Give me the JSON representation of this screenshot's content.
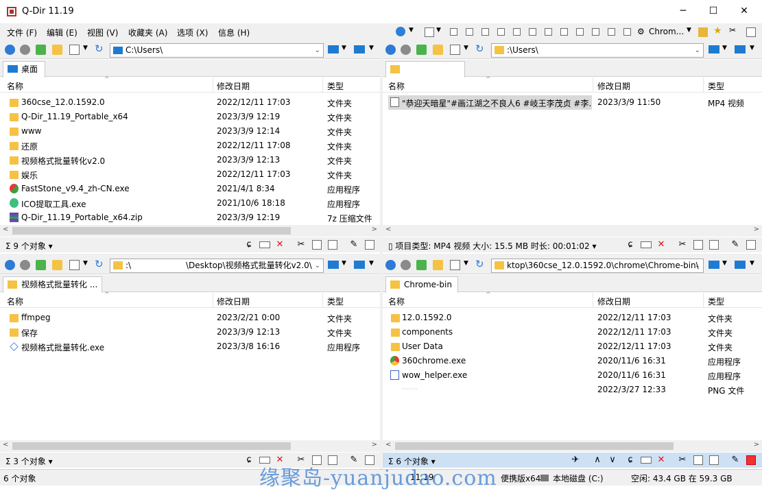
{
  "window": {
    "title": "Q-Dir 11.19",
    "minimize": "─",
    "maximize": "☐",
    "close": "✕"
  },
  "menu": [
    "文件 (F)",
    "编辑 (E)",
    "视图 (V)",
    "收藏夹 (A)",
    "选项 (X)",
    "信息 (H)"
  ],
  "toolbar": {
    "browser_label": "Chrom..."
  },
  "panes": {
    "top_left": {
      "address": "C:\\Users\\",
      "tab": "桌面",
      "columns": [
        "名称",
        "修改日期",
        "类型"
      ],
      "rows": [
        {
          "name": "360cse_12.0.1592.0",
          "date": "2022/12/11 17:03",
          "type": "文件夹",
          "icon": "folder"
        },
        {
          "name": "Q-Dir_11.19_Portable_x64",
          "date": "2023/3/9 12:19",
          "type": "文件夹",
          "icon": "folder"
        },
        {
          "name": "www",
          "date": "2023/3/9 12:14",
          "type": "文件夹",
          "icon": "folder"
        },
        {
          "name": "还原",
          "date": "2022/12/11 17:08",
          "type": "文件夹",
          "icon": "folder"
        },
        {
          "name": "视频格式批量转化v2.0",
          "date": "2023/3/9 12:13",
          "type": "文件夹",
          "icon": "folder"
        },
        {
          "name": "娱乐",
          "date": "2022/12/11 17:03",
          "type": "文件夹",
          "icon": "folder"
        },
        {
          "name": "FastStone_v9.4_zh-CN.exe",
          "date": "2021/4/1 8:34",
          "type": "应用程序",
          "icon": "faststone"
        },
        {
          "name": "ICO提取工具.exe",
          "date": "2021/10/6 18:18",
          "type": "应用程序",
          "icon": "ico"
        },
        {
          "name": "Q-Dir_11.19_Portable_x64.zip",
          "date": "2023/3/9 12:19",
          "type": "7z 压缩文件",
          "icon": "zip"
        }
      ],
      "status": "9 个对象"
    },
    "top_right": {
      "address": ":\\Users\\",
      "tab": "",
      "columns": [
        "名称",
        "修改日期",
        "类型"
      ],
      "rows": [
        {
          "name": "\"恭迎天暗星\"#画江湖之不良人6 #岐王李茂贞 #李...",
          "date": "2023/3/9 11:50",
          "type": "MP4 视频",
          "icon": "video"
        }
      ],
      "status": "项目类型: MP4 视频 大小: 15.5 MB 时长: 00:01:02"
    },
    "bottom_left": {
      "address_left": ":\\",
      "address_right": "\\Desktop\\视频格式批量转化v2.0\\",
      "tab": "视频格式批量转化 ...",
      "columns": [
        "名称",
        "修改日期",
        "类型"
      ],
      "rows": [
        {
          "name": "ffmpeg",
          "date": "2023/2/21 0:00",
          "type": "文件夹",
          "icon": "folder"
        },
        {
          "name": "保存",
          "date": "2023/3/9 12:13",
          "type": "文件夹",
          "icon": "folder"
        },
        {
          "name": "视频格式批量转化.exe",
          "date": "2023/3/8 16:16",
          "type": "应用程序",
          "icon": "app"
        }
      ],
      "status": "3 个对象"
    },
    "bottom_right": {
      "address": "ktop\\360cse_12.0.1592.0\\chrome\\Chrome-bin\\",
      "tab": "Chrome-bin",
      "columns": [
        "名称",
        "修改日期",
        "类型"
      ],
      "rows": [
        {
          "name": "12.0.1592.0",
          "date": "2022/12/11 17:03",
          "type": "文件夹",
          "icon": "folder"
        },
        {
          "name": "components",
          "date": "2022/12/11 17:03",
          "type": "文件夹",
          "icon": "folder"
        },
        {
          "name": "User Data",
          "date": "2022/12/11 17:03",
          "type": "文件夹",
          "icon": "folder"
        },
        {
          "name": "360chrome.exe",
          "date": "2020/11/6 16:31",
          "type": "应用程序",
          "icon": "chrome"
        },
        {
          "name": "wow_helper.exe",
          "date": "2020/11/6 16:31",
          "type": "应用程序",
          "icon": "app2"
        },
        {
          "name": "",
          "date": "2022/3/27 12:33",
          "type": "PNG 文件",
          "icon": "none"
        }
      ],
      "status": "6 个对象"
    }
  },
  "bottombar": {
    "count": "6 个对象",
    "version": "11.19",
    "portable": "便携版x64",
    "drive": "本地磁盘 (C:)",
    "free": "空闲: 43.4 GB 在 59.3 GB"
  },
  "watermark": "缘聚岛-yuanjudao.com"
}
